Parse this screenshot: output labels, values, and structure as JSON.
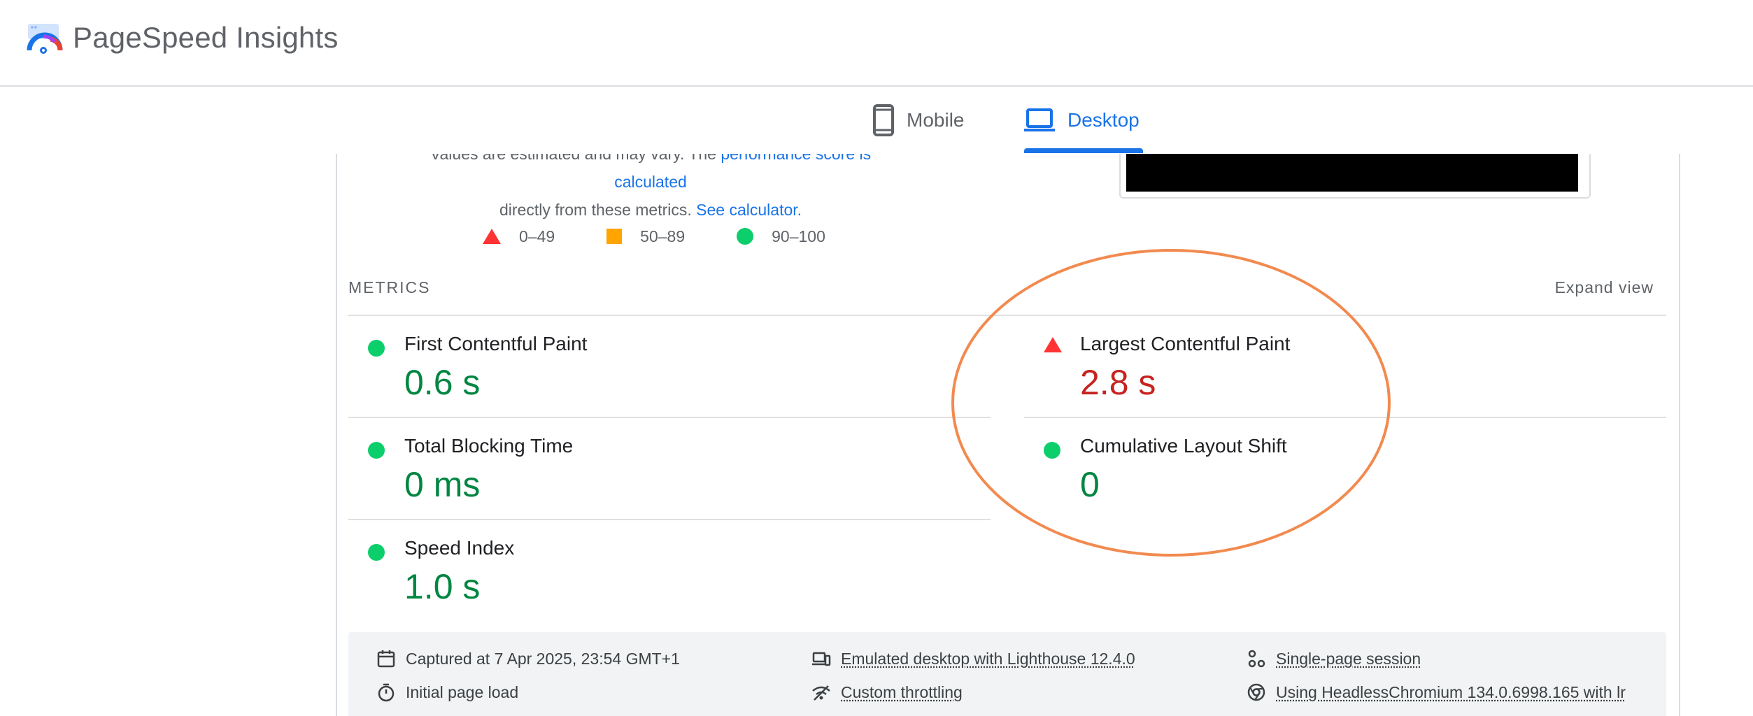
{
  "header": {
    "brand": "PageSpeed Insights"
  },
  "tabs": [
    {
      "label": "Mobile",
      "selected": false
    },
    {
      "label": "Desktop",
      "selected": true
    }
  ],
  "intro": {
    "line1_prefix": "Values are estimated and may vary. The ",
    "line1_link": "performance score is calculated",
    "line2_prefix": "directly from these metrics.",
    "line2_link": "See calculator."
  },
  "legend": [
    {
      "range": "0–49",
      "shape": "triangle",
      "color": "#ff3333"
    },
    {
      "range": "50–89",
      "shape": "square",
      "color": "#ffa400"
    },
    {
      "range": "90–100",
      "shape": "circle",
      "color": "#0cce6b"
    }
  ],
  "metrics": {
    "title": "METRICS",
    "expand_label": "Expand view",
    "items": [
      {
        "name": "First Contentful Paint",
        "value": "0.6 s",
        "status": "good"
      },
      {
        "name": "Largest Contentful Paint",
        "value": "2.8 s",
        "status": "poor"
      },
      {
        "name": "Total Blocking Time",
        "value": "0 ms",
        "status": "good"
      },
      {
        "name": "Cumulative Layout Shift",
        "value": "0",
        "status": "good"
      },
      {
        "name": "Speed Index",
        "value": "1.0 s",
        "status": "good"
      }
    ]
  },
  "runtime": {
    "captured": "Captured at 7 Apr 2025, 23:54 GMT+1",
    "emulated": "Emulated desktop with Lighthouse 12.4.0",
    "session": "Single-page session",
    "initial_load": "Initial page load",
    "throttling": "Custom throttling",
    "browser": "Using HeadlessChromium 134.0.6998.165 with lr"
  },
  "colors": {
    "accent": "#1a73e8",
    "good": "#018642",
    "poor": "#c7221f",
    "highlight": "#f28a4f"
  }
}
